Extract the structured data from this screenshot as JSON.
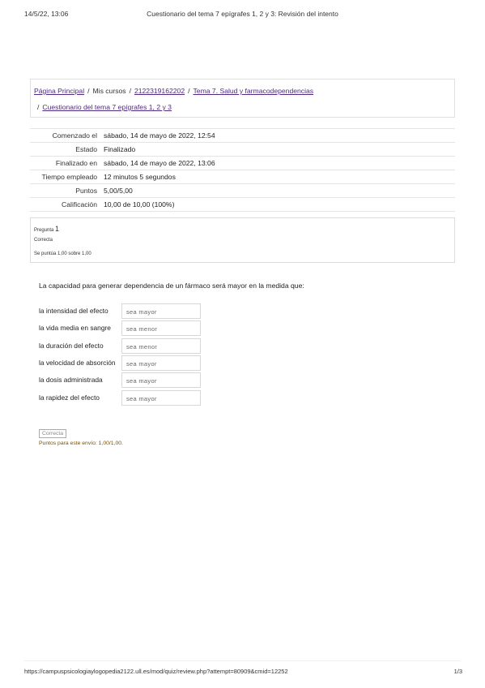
{
  "print_header": {
    "date": "14/5/22, 13:06",
    "title": "Cuestionario del tema 7 epígrafes 1, 2 y 3: Revisión del intento"
  },
  "breadcrumb": {
    "home": "Página Principal",
    "my_courses": "Mis cursos",
    "course": "2122319162202",
    "topic": "Tema 7. Salud y farmacodependencias",
    "quiz": "Cuestionario del tema 7 epígrafes 1, 2 y 3"
  },
  "summary": [
    {
      "label": "Comenzado el",
      "value": "sábado, 14 de mayo de 2022, 12:54"
    },
    {
      "label": "Estado",
      "value": "Finalizado"
    },
    {
      "label": "Finalizado en",
      "value": "sábado, 14 de mayo de 2022, 13:06"
    },
    {
      "label": "Tiempo empleado",
      "value": "12 minutos 5 segundos"
    },
    {
      "label": "Puntos",
      "value": "5,00/5,00"
    },
    {
      "label": "Calificación",
      "value": "10,00 de 10,00 (100%)"
    }
  ],
  "question_info": {
    "prefix": "Pregunta",
    "number": "1",
    "state": "Correcta",
    "grade": "Se puntúa 1,00 sobre 1,00"
  },
  "question": {
    "text": "La capacidad para generar dependencia de un fármaco será mayor en la medida que:",
    "matches": [
      {
        "label": "la intensidad del efecto",
        "answer": "sea mayor"
      },
      {
        "label": "la vida media en sangre",
        "answer": "sea menor"
      },
      {
        "label": "la duración del efecto",
        "answer": "sea menor"
      },
      {
        "label": "la velocidad de absorción",
        "answer": "sea mayor"
      },
      {
        "label": "la dosis administrada",
        "answer": "sea mayor"
      },
      {
        "label": "la rapidez del efecto",
        "answer": "sea mayor"
      }
    ],
    "feedback_badge": "Correcta",
    "points_note": "Puntos para este envío: 1,00/1,00."
  },
  "footer": {
    "url": "https://campuspsicologiaylogopedia2122.ull.es/mod/quiz/review.php?attempt=80909&cmid=12252",
    "page": "1/3"
  }
}
